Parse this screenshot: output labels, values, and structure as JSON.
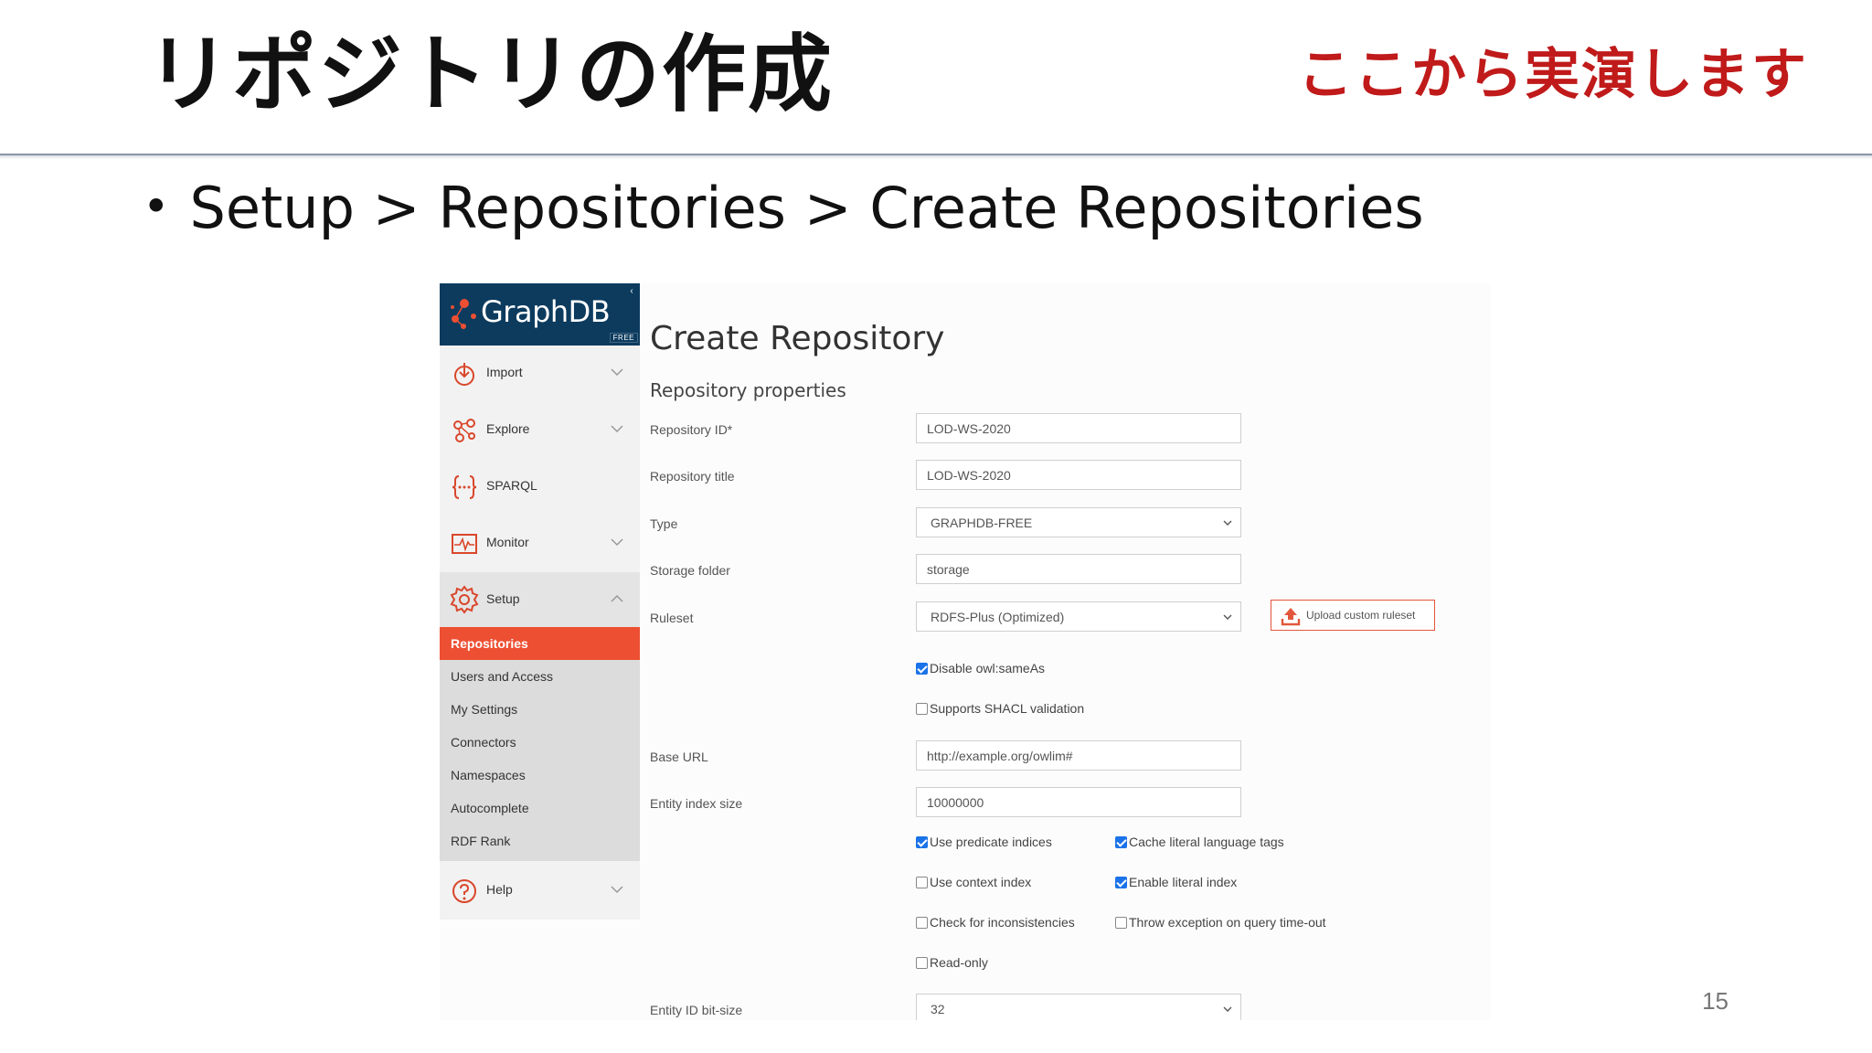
{
  "slide": {
    "title": "リポジトリの作成",
    "note": "ここから実演します",
    "bullet": "Setup > Repositories > Create Repositories",
    "page_number": "15"
  },
  "app": {
    "logo_text": "GraphDB",
    "logo_badge": "FREE",
    "collapse_icon": "‹",
    "accent_color": "#ed4f32",
    "navbar_color": "#0c3b5e"
  },
  "sidebar": {
    "items": [
      {
        "label": "Import",
        "icon": "import-icon",
        "expandable": true
      },
      {
        "label": "Explore",
        "icon": "explore-icon",
        "expandable": true
      },
      {
        "label": "SPARQL",
        "icon": "sparql-icon",
        "expandable": false
      },
      {
        "label": "Monitor",
        "icon": "monitor-icon",
        "expandable": true
      },
      {
        "label": "Setup",
        "icon": "gear-icon",
        "expandable": true,
        "expanded": true
      },
      {
        "label": "Help",
        "icon": "help-icon",
        "expandable": true
      }
    ],
    "setup_submenu": [
      {
        "label": "Repositories",
        "active": true
      },
      {
        "label": "Users and Access"
      },
      {
        "label": "My Settings"
      },
      {
        "label": "Connectors"
      },
      {
        "label": "Namespaces"
      },
      {
        "label": "Autocomplete"
      },
      {
        "label": "RDF Rank"
      }
    ]
  },
  "form": {
    "heading": "Create Repository",
    "section": "Repository properties",
    "fields": {
      "repo_id": {
        "label": "Repository ID*",
        "value": "LOD-WS-2020"
      },
      "repo_title": {
        "label": "Repository title",
        "value": "LOD-WS-2020"
      },
      "type": {
        "label": "Type",
        "value": "GRAPHDB-FREE"
      },
      "storage": {
        "label": "Storage folder",
        "value": "storage"
      },
      "ruleset": {
        "label": "Ruleset",
        "value": "RDFS-Plus (Optimized)"
      },
      "base_url": {
        "label": "Base URL",
        "value": "http://example.org/owlim#"
      },
      "entity_index_size": {
        "label": "Entity index size",
        "value": "10000000"
      },
      "entity_id_bitsize": {
        "label": "Entity ID bit-size",
        "value": "32"
      }
    },
    "upload_button": "Upload custom ruleset",
    "checkboxes": {
      "disable_sameas": {
        "label": "Disable owl:sameAs",
        "checked": true
      },
      "shacl": {
        "label": "Supports SHACL validation",
        "checked": false
      },
      "predicate_indices": {
        "label": "Use predicate indices",
        "checked": true
      },
      "cache_lang_tags": {
        "label": "Cache literal language tags",
        "checked": true
      },
      "context_index": {
        "label": "Use context index",
        "checked": false
      },
      "literal_index": {
        "label": "Enable literal index",
        "checked": true
      },
      "inconsistencies": {
        "label": "Check for inconsistencies",
        "checked": false
      },
      "throw_timeout": {
        "label": "Throw exception on query time-out",
        "checked": false
      },
      "read_only": {
        "label": "Read-only",
        "checked": false
      }
    }
  }
}
